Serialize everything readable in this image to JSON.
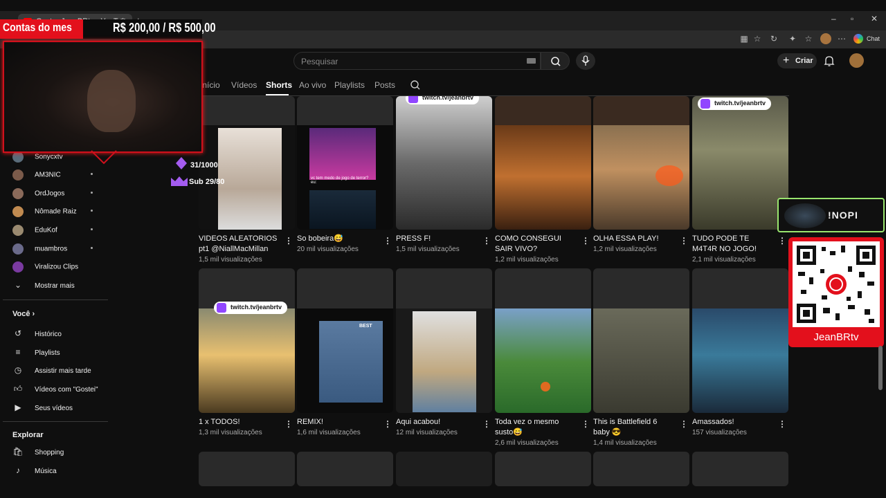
{
  "browser": {
    "tab_title": "Gaster JeanBRtv - YouTube",
    "chat_label": "Chat"
  },
  "youtube": {
    "search_placeholder": "Pesquisar",
    "create_label": "Criar",
    "tabs": [
      "Início",
      "Vídeos",
      "Shorts",
      "Ao vivo",
      "Playlists",
      "Posts"
    ],
    "active_tab": "Shorts"
  },
  "sidebar": {
    "subscriptions": [
      "Sonycxtv",
      "AM3NIC",
      "OrdJogos",
      "Nômade Raiz",
      "EduKof",
      "muambros",
      "Viralizou Clips"
    ],
    "show_more": "Mostrar mais",
    "you_header": "Você",
    "you_items": [
      "Histórico",
      "Playlists",
      "Assistir mais tarde",
      "Vídeos com \"Gostei\"",
      "Seus vídeos"
    ],
    "explore_header": "Explorar",
    "explore_items": [
      "Shopping",
      "Música"
    ]
  },
  "shorts": {
    "row1": [
      {
        "title": "VIDEOS ALEATORIOS pt1 @NiallMacMillan",
        "views": "1,5 mil visualizações"
      },
      {
        "title": "So bobeira😅",
        "views": "20 mil visualizações"
      },
      {
        "title": "PRESS F!",
        "views": "1,5 mil visualizações"
      },
      {
        "title": "COMO CONSEGUI SAIR VIVO?",
        "views": "1,2 mil visualizações"
      },
      {
        "title": "OLHA ESSA PLAY!",
        "views": "1,2 mil visualizações"
      },
      {
        "title": "TUDO PODE TE M4T4R NO JOGO!",
        "views": "2,1 mil visualizações"
      }
    ],
    "row2": [
      {
        "title": "1 x TODOS!",
        "views": "1,3 mil visualizações"
      },
      {
        "title": "REMIX!",
        "views": "1,6 mil visualizações"
      },
      {
        "title": "Aqui acabou!",
        "views": "12 mil visualizações"
      },
      {
        "title": "Toda vez o mesmo susto😅",
        "views": "2,6 mil visualizações"
      },
      {
        "title": "This is Battlefield 6 baby 😎",
        "views": "1,4 mil visualizações"
      },
      {
        "title": "Amassados!",
        "views": "157 visualizações"
      }
    ],
    "thumb_texts": {
      "twitch_handle": "twitch.tv/jeanbrtv",
      "caption_terror": "vc tem medo de jogo de terror? eu:",
      "caption_best": "BEST"
    }
  },
  "overlay": {
    "title": "Contas do mes",
    "goal": "R$ 200,00 / R$ 500,00",
    "followers": "31/1000",
    "subs": "Sub 29/80",
    "sponsor": "!NOPI",
    "qr_label": "JeanBRtv"
  },
  "colors": {
    "overlay_red": "#e3101c",
    "twitch_purple": "#9146ff",
    "sponsor_green": "#9ae66e"
  }
}
